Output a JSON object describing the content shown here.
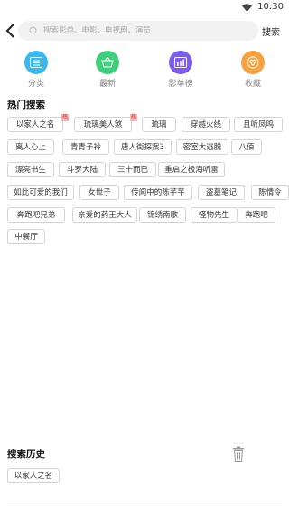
{
  "status_bar": {
    "time": "10:30"
  },
  "search": {
    "placeholder": "搜索影单、电影、电视剧、演员",
    "button_label": "搜索"
  },
  "categories": [
    {
      "label": "分类",
      "icon": "list-icon",
      "color": "#37b9f3"
    },
    {
      "label": "最新",
      "icon": "basket-icon",
      "color": "#3fce7c"
    },
    {
      "label": "影单榜",
      "icon": "chart-icon",
      "color": "#7d5cf0"
    },
    {
      "label": "收藏",
      "icon": "heart-icon",
      "color": "#f8a13f"
    }
  ],
  "hot_search": {
    "title": "热门搜索",
    "badge": "热",
    "tags": [
      "以家人之名",
      "琉璃美人煞",
      "琉璃",
      "穿越火线",
      "且听凤鸣",
      "离人心上",
      "青青子衿",
      "唐人街探案3",
      "密室大逃脱",
      "八佰",
      "漂亮书生",
      "斗罗大陆",
      "三十而已",
      "重启之极海听雷",
      "如此可爱的我们",
      "女世子",
      "传闻中的陈芊芊",
      "盗墓笔记",
      "陈情令",
      "奔跑吧兄弟",
      "亲爱的药王大人",
      "锦绣南歌",
      "怪物先生",
      "奔跑吧",
      "中餐厅"
    ]
  },
  "history": {
    "title": "搜索历史",
    "items": [
      "以家人之名"
    ]
  }
}
